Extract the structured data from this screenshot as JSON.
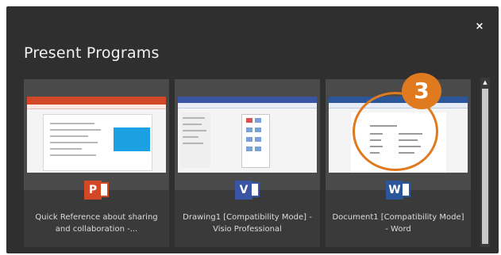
{
  "dialog": {
    "title": "Present Programs",
    "close_glyph": "×",
    "accent_color": "#e07a1f"
  },
  "programs": [
    {
      "app": "PowerPoint",
      "icon": "powerpoint-icon",
      "icon_letter": "P",
      "icon_color": "#d24726",
      "label": "Quick Reference about sharing and collaboration -..."
    },
    {
      "app": "Visio",
      "icon": "visio-icon",
      "icon_letter": "V",
      "icon_color": "#3955a3",
      "label": "Drawing1  [Compatibility Mode] - Visio Professional"
    },
    {
      "app": "Word",
      "icon": "word-icon",
      "icon_letter": "W",
      "icon_color": "#2b579a",
      "label": "Document1 [Compatibility Mode] - Word"
    }
  ],
  "annotation": {
    "step_number": "3"
  },
  "scrollbar": {
    "up_arrow_glyph": "▲"
  }
}
